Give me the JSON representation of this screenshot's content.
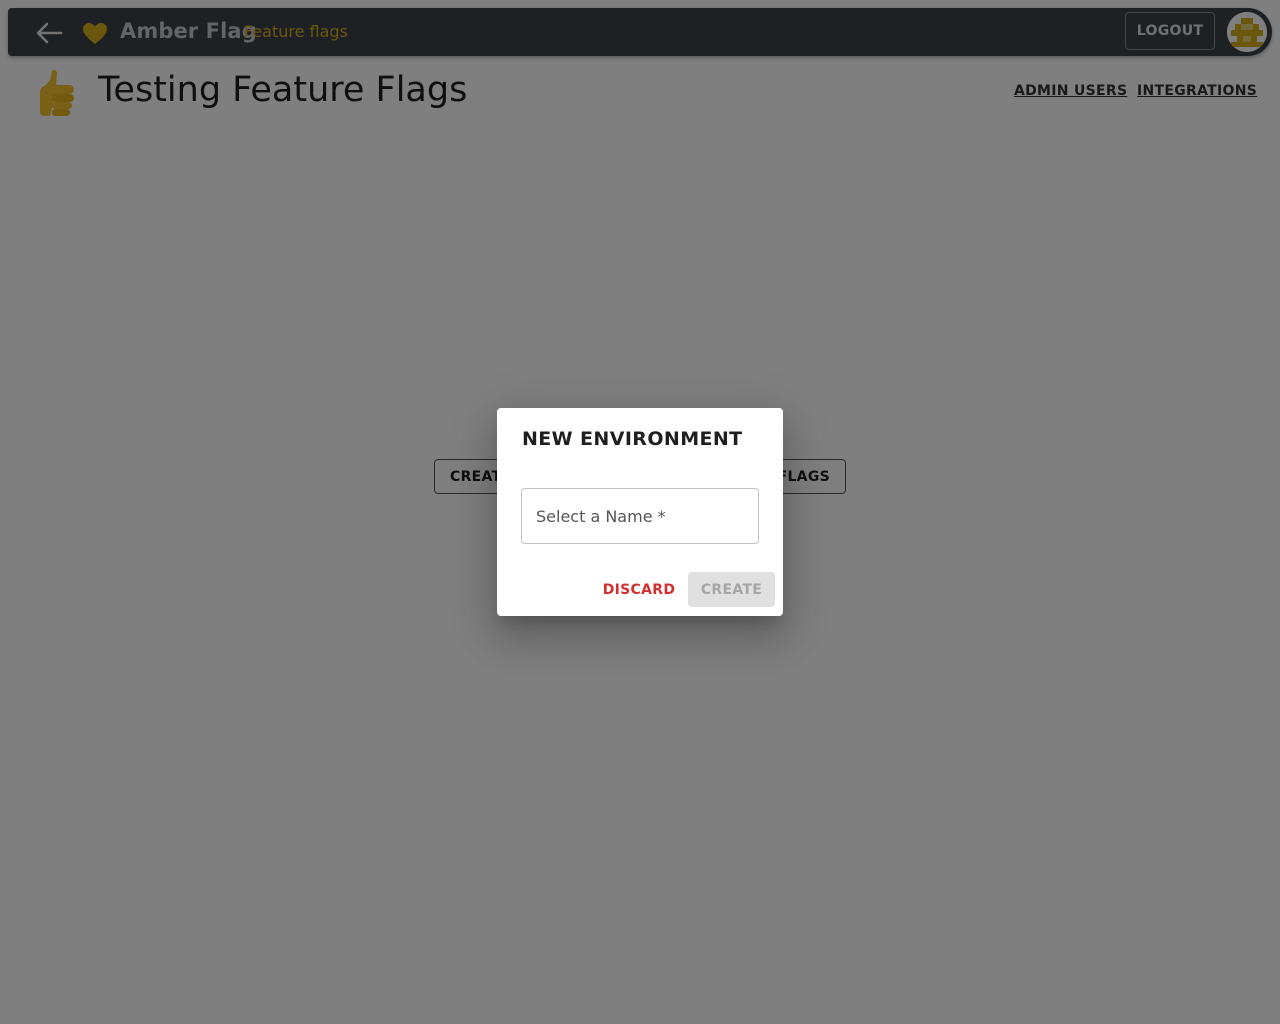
{
  "appbar": {
    "brand_name": "Amber Flag",
    "brand_sub": "Feature flags",
    "logout_label": "LOGOUT",
    "accent_color": "#d9ae1d"
  },
  "header": {
    "title": "Testing Feature Flags",
    "links": [
      "ADMIN USERS",
      "INTEGRATIONS"
    ]
  },
  "background_buttons": {
    "create_label": "CREAT",
    "flags_label": "FLAGS"
  },
  "dialog": {
    "title": "NEW ENVIRONMENT",
    "name_label": "Select a Name *",
    "name_value": "",
    "discard_label": "DISCARD",
    "create_label": "CREATE",
    "discard_color": "#d32f2f"
  },
  "icons": [
    "back-arrow-icon",
    "heart-icon",
    "avatar",
    "thumbs-up-icon"
  ]
}
